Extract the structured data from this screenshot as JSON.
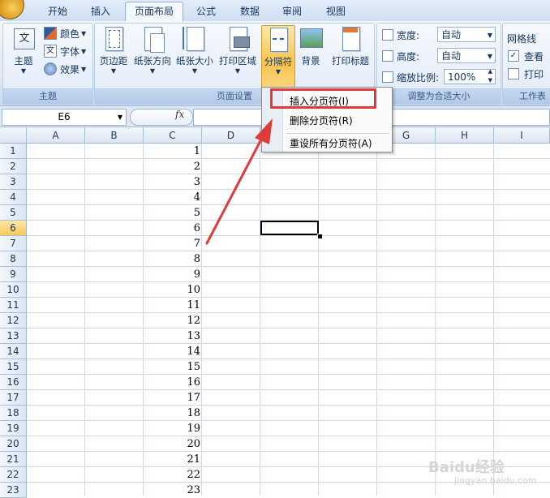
{
  "tabs": [
    {
      "label": "开始",
      "active": false
    },
    {
      "label": "插入",
      "active": false
    },
    {
      "label": "页面布局",
      "active": true
    },
    {
      "label": "公式",
      "active": false
    },
    {
      "label": "数据",
      "active": false
    },
    {
      "label": "审阅",
      "active": false
    },
    {
      "label": "视图",
      "active": false
    }
  ],
  "ribbon": {
    "theme_group": {
      "label": "主题",
      "theme_btn": "主题",
      "colors": "颜色",
      "fonts": "字体",
      "effects": "效果"
    },
    "page_setup_group": {
      "label": "页面设置",
      "margins": "页边距",
      "orientation": "纸张方向",
      "size": "纸张大小",
      "print_area": "打印区域",
      "breaks": "分隔符",
      "background": "背景",
      "print_titles": "打印标题"
    },
    "scale_group": {
      "label": "调整为合适大小",
      "width_label": "宽度:",
      "width_value": "自动",
      "height_label": "高度:",
      "height_value": "自动",
      "scale_label": "缩放比例:",
      "scale_value": "100%"
    },
    "sheet_options_group": {
      "label": "工作表",
      "gridlines": "网格线",
      "view": "查看",
      "print": "打印"
    }
  },
  "formula_bar": {
    "name_box": "E6",
    "fx": "fx",
    "value": ""
  },
  "columns": [
    "A",
    "B",
    "C",
    "D",
    "E",
    "F",
    "G",
    "H",
    "I"
  ],
  "rows": [
    "1",
    "2",
    "3",
    "4",
    "5",
    "6",
    "7",
    "8",
    "9",
    "10",
    "11",
    "12",
    "13",
    "14",
    "15",
    "16",
    "17",
    "18",
    "19",
    "20",
    "21",
    "22",
    "23"
  ],
  "column_c_values": [
    "1",
    "2",
    "3",
    "4",
    "5",
    "6",
    "7",
    "8",
    "9",
    "10",
    "11",
    "12",
    "13",
    "14",
    "15",
    "16",
    "17",
    "18",
    "19",
    "20",
    "21",
    "22",
    "23"
  ],
  "selected_cell": "E6",
  "breaks_menu": {
    "items": [
      {
        "label": "插入分页符(I)",
        "highlighted": true
      },
      {
        "label": "删除分页符(R)",
        "highlighted": false
      },
      {
        "label": "重设所有分页符(A)",
        "highlighted": false
      }
    ]
  },
  "watermark": {
    "brand": "Baidu经验",
    "url": "jingyan.baidu.com"
  },
  "colors": {
    "annotation_red": "#e03a3a",
    "active_yellow": "#f8c85a"
  }
}
